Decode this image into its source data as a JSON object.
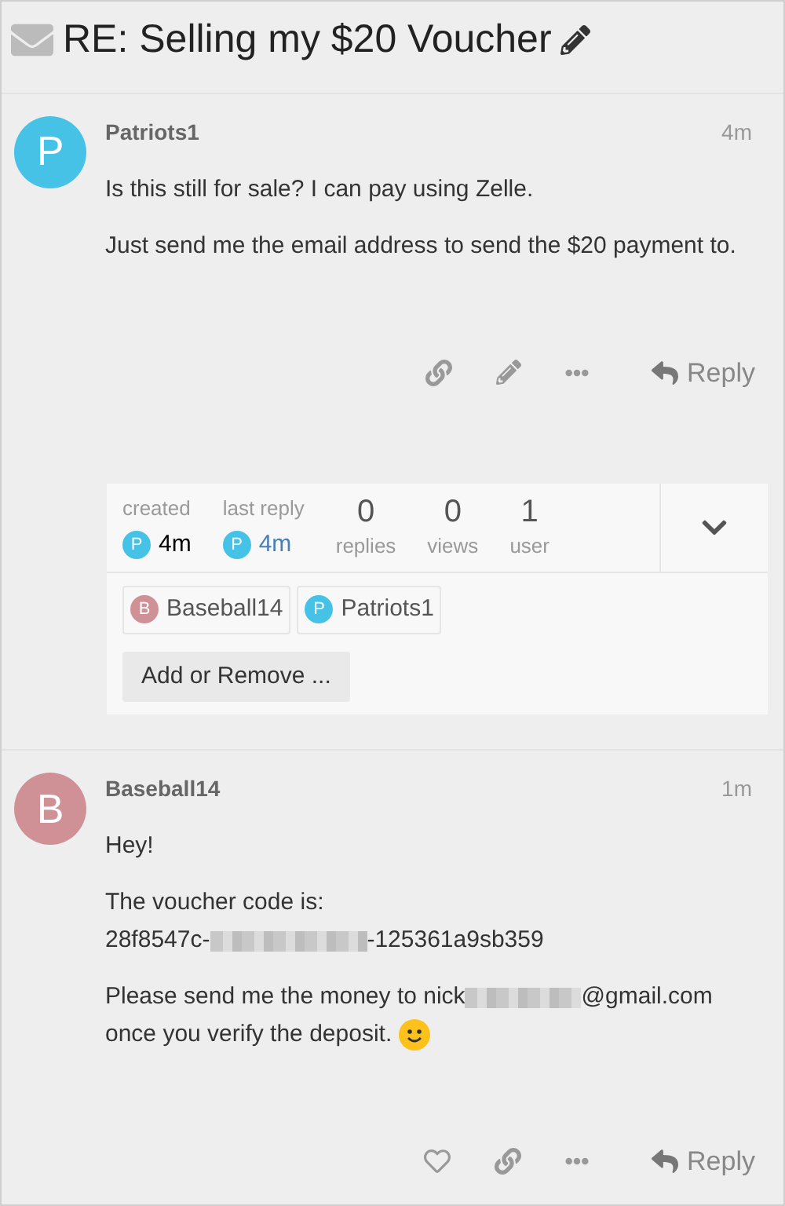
{
  "title": "RE: Selling my $20 Voucher",
  "posts": [
    {
      "avatar": "P",
      "color": "#45c2e6",
      "author": "Patriots1",
      "time": "4m",
      "paragraphs": [
        [
          {
            "kind": "text",
            "text": "Is this still for sale? I can pay using Zelle."
          }
        ],
        [
          {
            "kind": "text",
            "text": "Just send me the email address to send the $20 payment to."
          }
        ]
      ],
      "actions": [
        {
          "kind": "link"
        },
        {
          "kind": "edit"
        },
        {
          "kind": "more"
        },
        {
          "kind": "reply",
          "label": "Reply"
        }
      ],
      "topic_map": {
        "created": {
          "label": "created",
          "avatar": "P",
          "color": "#45c2e6",
          "time": "4m"
        },
        "last_reply": {
          "label": "last reply",
          "avatar": "P",
          "color": "#45c2e6",
          "time": "4m"
        },
        "stats": [
          {
            "value": "0",
            "label": "replies"
          },
          {
            "value": "0",
            "label": "views"
          },
          {
            "value": "1",
            "label": "user"
          }
        ],
        "participants": [
          {
            "avatar": "B",
            "color": "#d09196",
            "name": "Baseball14"
          },
          {
            "avatar": "P",
            "color": "#45c2e6",
            "name": "Patriots1"
          }
        ],
        "add_button": "Add or Remove ..."
      }
    },
    {
      "avatar": "B",
      "color": "#d09196",
      "author": "Baseball14",
      "time": "1m",
      "paragraphs": [
        [
          {
            "kind": "text",
            "text": "Hey!"
          }
        ],
        [
          {
            "kind": "text",
            "text": "The voucher code is:"
          },
          {
            "kind": "break"
          },
          {
            "kind": "text",
            "text": "28f8547c-"
          },
          {
            "kind": "redacted_long"
          },
          {
            "kind": "text",
            "text": "-125361a9sb359"
          }
        ],
        [
          {
            "kind": "text",
            "text": "Please send me the money to nick"
          },
          {
            "kind": "redacted_short"
          },
          {
            "kind": "text",
            "text": "@gmail.com"
          },
          {
            "kind": "break"
          },
          {
            "kind": "text",
            "text": "once you verify the deposit."
          },
          {
            "kind": "emoji"
          }
        ]
      ],
      "actions": [
        {
          "kind": "like"
        },
        {
          "kind": "link"
        },
        {
          "kind": "more"
        },
        {
          "kind": "reply",
          "label": "Reply"
        }
      ]
    }
  ]
}
